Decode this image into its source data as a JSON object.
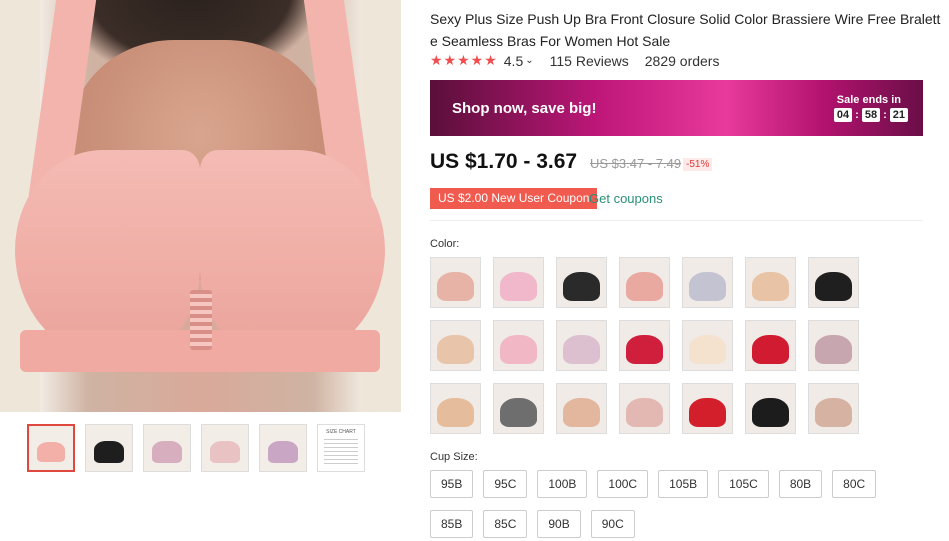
{
  "product": {
    "title": "Sexy Plus Size Push Up Bra Front Closure Solid Color Brassiere Wire Free Bralette Seamless Bras For Women Hot Sale",
    "rating": "4.5",
    "rating_chevron": "⌄",
    "reviews": "115 Reviews",
    "orders": "2829 orders",
    "stars": "★★★★★"
  },
  "promo": {
    "headline": "Shop now, save big!",
    "sale_ends_label": "Sale ends in",
    "timer": {
      "hours": "04",
      "minutes": "58",
      "seconds": "21"
    }
  },
  "price": {
    "current": "US $1.70 - 3.67",
    "original": "US $3.47 - 7.49",
    "discount": "-51%"
  },
  "coupon": {
    "tag": "US $2.00 New User Coupon",
    "link": "Get coupons"
  },
  "color": {
    "label": "Color:",
    "swatches": [
      "#e7b3a6",
      "#f1b8cb",
      "#2a2a2a",
      "#e9a9a0",
      "#c3c3d2",
      "#e8c3a5",
      "#1f1f1f",
      "#e8c4aa",
      "#f1b7c4",
      "#dcc0cf",
      "#cf1f3d",
      "#f4e2cf",
      "#d01b31",
      "#c7a6b0",
      "#e6bd9c",
      "#6e6e6e",
      "#e2b79e",
      "#e4b8b2",
      "#d31f2c",
      "#1c1c1c",
      "#d6b2a2"
    ]
  },
  "cup_size": {
    "label": "Cup Size:",
    "rows": [
      [
        "95B",
        "95C",
        "100B",
        "100C",
        "105B",
        "105C",
        "80B",
        "80C"
      ],
      [
        "85B",
        "85C",
        "90B",
        "90C"
      ]
    ]
  },
  "gallery": {
    "thumb_colors": [
      "#f2b0a8",
      "#1e1e1e",
      "#d7aebd",
      "#e9c2c4",
      "#c9a6c4"
    ],
    "size_chart_caption": "SIZE CHART"
  }
}
